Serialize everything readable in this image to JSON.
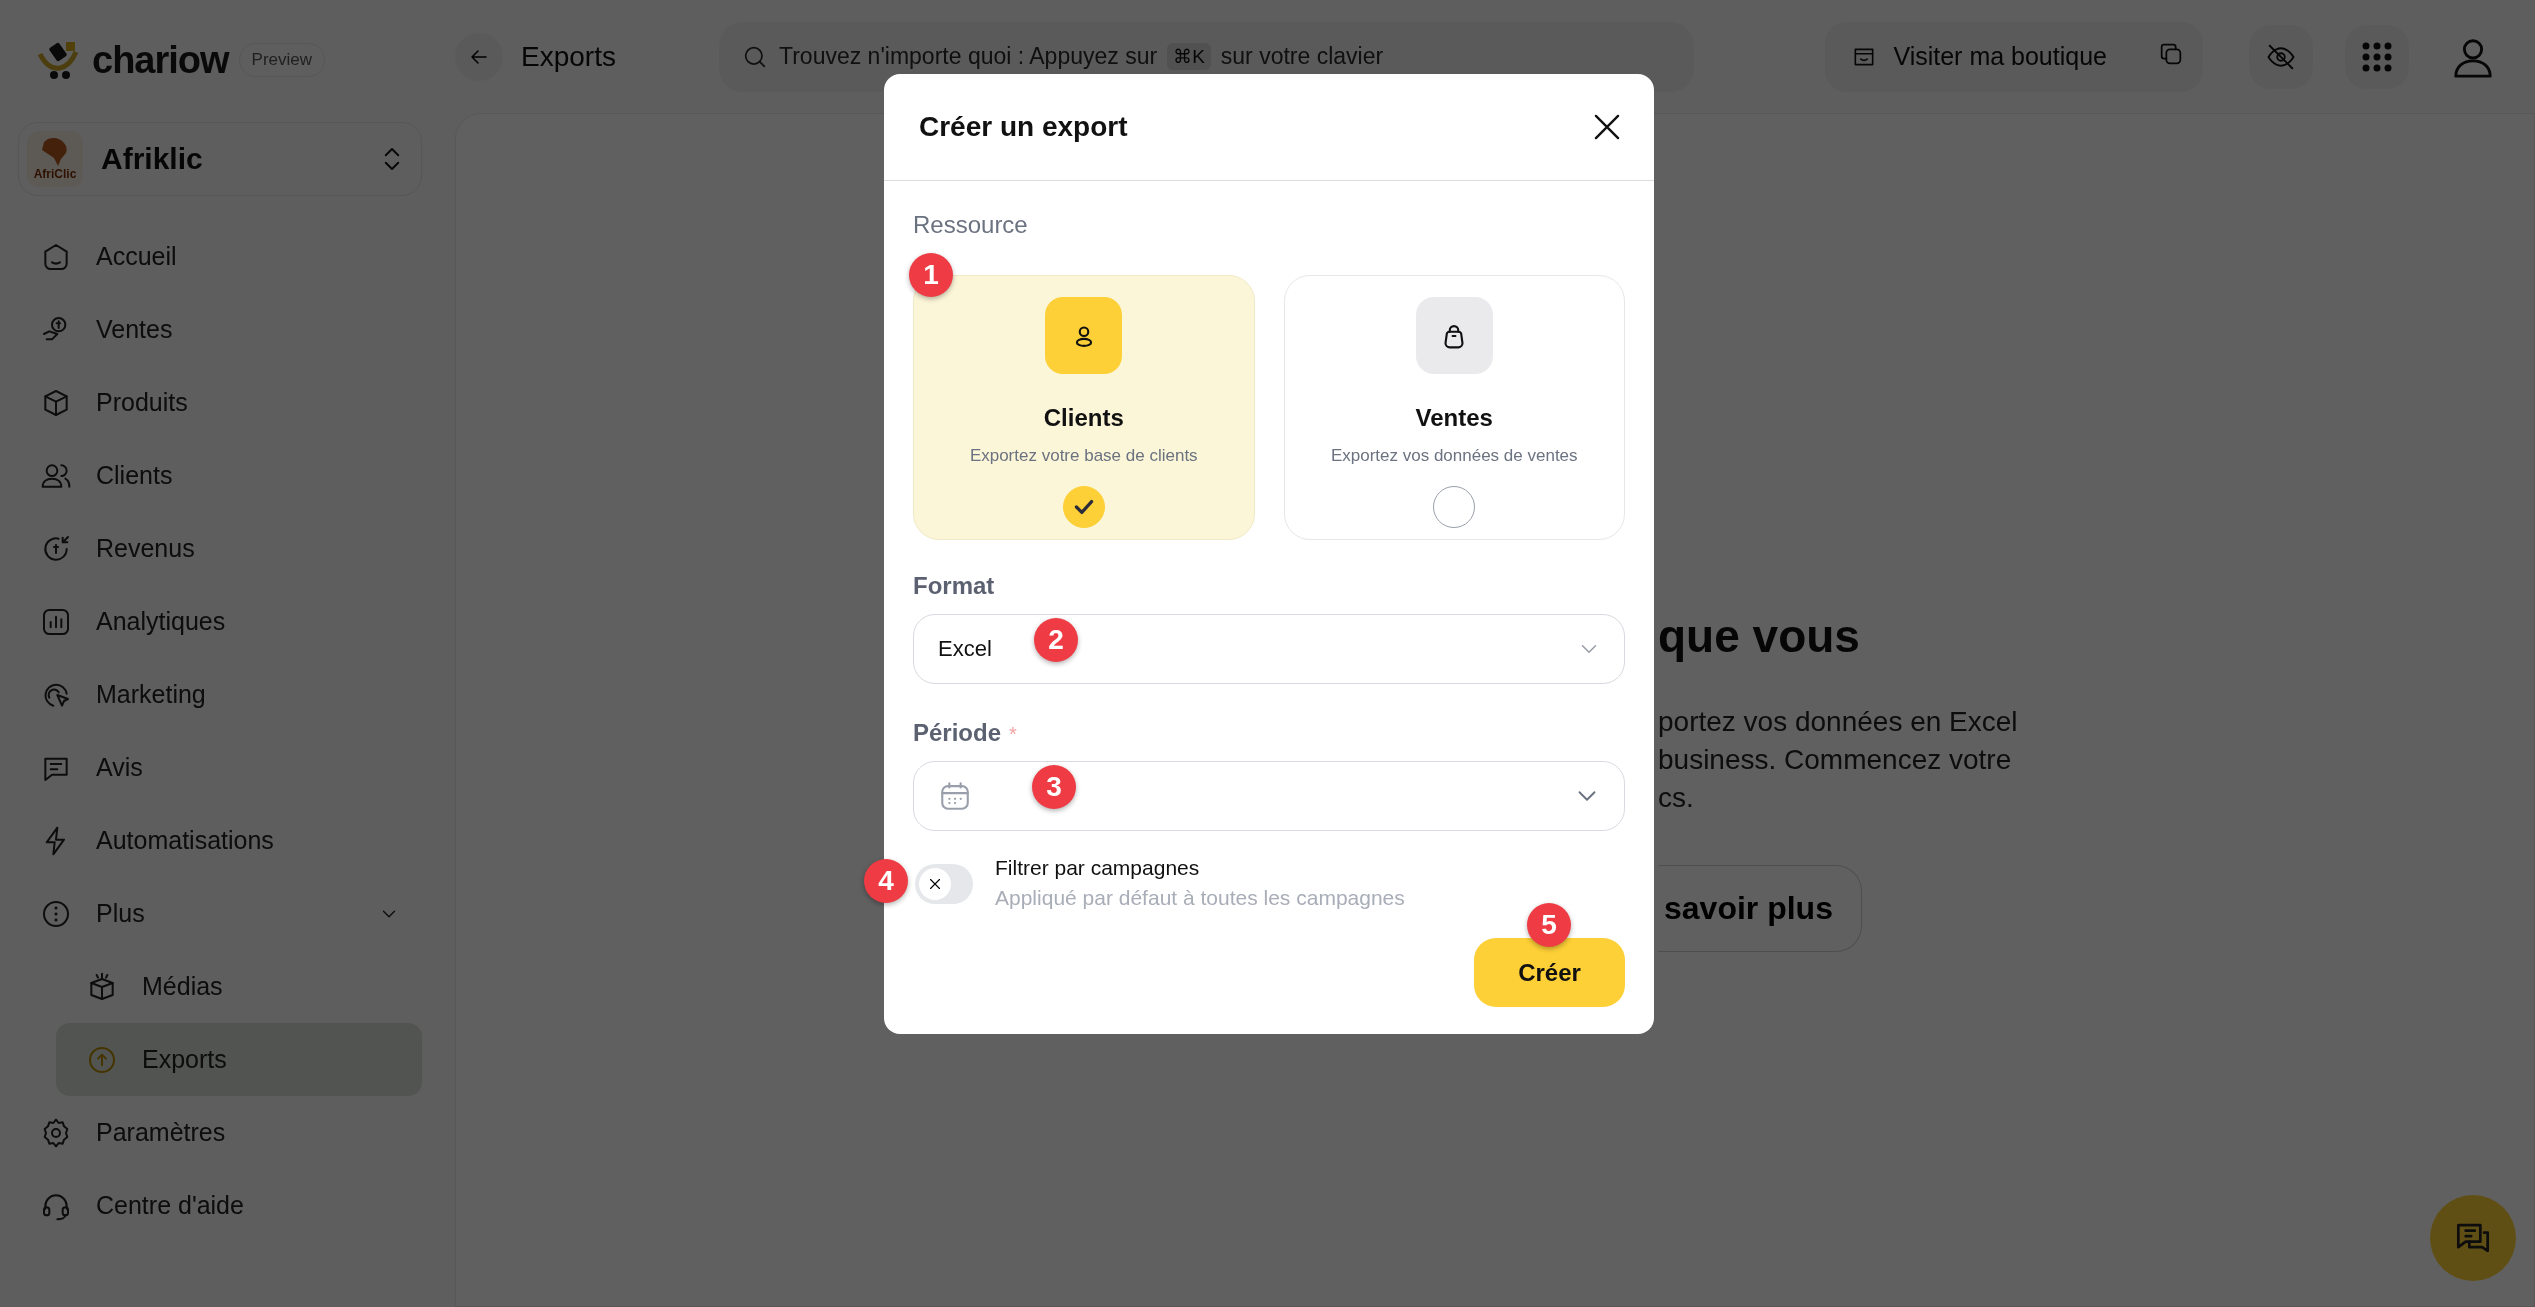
{
  "brand": {
    "name": "chariow",
    "badge": "Preview"
  },
  "store": {
    "name": "Afriklic",
    "logo_text": "AfriClic"
  },
  "sidebar": {
    "items": [
      {
        "label": "Accueil",
        "selected": false
      },
      {
        "label": "Ventes",
        "selected": false
      },
      {
        "label": "Produits",
        "selected": false
      },
      {
        "label": "Clients",
        "selected": false
      },
      {
        "label": "Revenus",
        "selected": false
      },
      {
        "label": "Analytiques",
        "selected": false
      },
      {
        "label": "Marketing",
        "selected": false
      },
      {
        "label": "Avis",
        "selected": false
      },
      {
        "label": "Automatisations",
        "selected": false
      },
      {
        "label": "Plus",
        "selected": false,
        "expanded": true,
        "children": [
          {
            "label": "Médias",
            "selected": false
          },
          {
            "label": "Exports",
            "selected": true
          }
        ]
      },
      {
        "label": "Paramètres",
        "selected": false
      },
      {
        "label": "Centre d'aide",
        "selected": false
      }
    ]
  },
  "header": {
    "title": "Exports",
    "search": {
      "hint": "Trouvez n'importe quoi : Appuyez sur",
      "shortcut": "⌘K",
      "hint_end": "sur votre clavier"
    },
    "shop_button": "Visiter ma boutique"
  },
  "background": {
    "heading": "que vous",
    "lines": [
      "portez vos données en Excel",
      "business. Commencez votre",
      "cs."
    ],
    "button": "savoir plus"
  },
  "modal": {
    "title": "Créer un export",
    "resource_label": "Ressource",
    "resources": [
      {
        "title": "Clients",
        "description": "Exportez votre base de clients",
        "selected": true
      },
      {
        "title": "Ventes",
        "description": "Exportez vos données de ventes",
        "selected": false
      }
    ],
    "format": {
      "label": "Format",
      "value": "Excel"
    },
    "period": {
      "label": "Période",
      "required_mark": "*"
    },
    "campaign_filter": {
      "label": "Filtrer par campagnes",
      "hint": "Appliqué par défaut à toutes les campagnes",
      "on": false
    },
    "submit": "Créer"
  },
  "markers": [
    "1",
    "2",
    "3",
    "4",
    "5"
  ]
}
